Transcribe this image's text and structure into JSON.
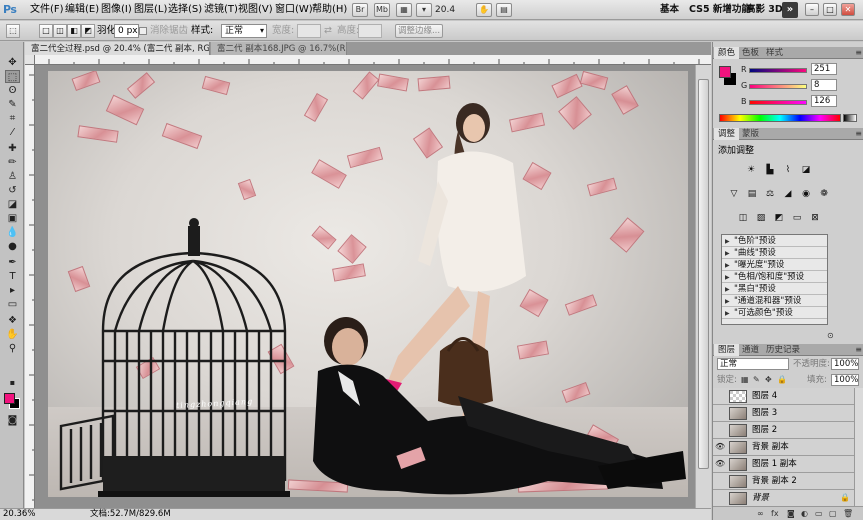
{
  "menubar": {
    "logo": "Ps",
    "items": [
      "文件(F)",
      "编辑(E)",
      "图像(I)",
      "图层(L)",
      "选择(S)",
      "滤镜(T)",
      "视图(V)",
      "窗口(W)",
      "帮助(H)"
    ],
    "zoom": "20.4",
    "workspaces": [
      "基本",
      "CS5 新增功能",
      "高影 3D"
    ],
    "more": "»"
  },
  "options": {
    "feather_label": "羽化:",
    "feather_value": "0 px",
    "antialias_label": "消除锯齿",
    "style_label": "样式:",
    "style_value": "正常",
    "width_label": "宽度:",
    "height_label": "高度:",
    "refine_label": "调整边缘..."
  },
  "tabs": [
    {
      "label": "富二代全过程.psd @ 20.4% (富二代 副本, RGB/8) *"
    },
    {
      "label": "富二代 副本168.JPG @ 16.7%(RGB/8)"
    }
  ],
  "canvas": {
    "watermark": "tingzhongqiang"
  },
  "status": {
    "zoom": "20.36%",
    "doc": "文档:52.7M/829.6M"
  },
  "color_panel": {
    "tabs": [
      "颜色",
      "色板",
      "样式"
    ],
    "r_label": "R",
    "r": "251",
    "g_label": "G",
    "g": "8",
    "b_label": "B",
    "b": "126",
    "fg": "#f2137e",
    "bg": "#000000"
  },
  "adjust_panel": {
    "tabs": [
      "调整",
      "蒙版"
    ],
    "title": "添加调整",
    "presets": [
      "\"色阶\"预设",
      "\"曲线\"预设",
      "\"曝光度\"预设",
      "\"色相/饱和度\"预设",
      "\"黑白\"预设",
      "\"通道混和器\"预设",
      "\"可选颜色\"预设"
    ]
  },
  "layers_panel": {
    "tabs": [
      "图层",
      "通道",
      "历史记录"
    ],
    "blend_mode": "正常",
    "opacity_label": "不透明度:",
    "opacity": "100%",
    "lock_label": "锁定:",
    "fill_label": "填充:",
    "fill": "100%",
    "layers": [
      {
        "name": "图层 4"
      },
      {
        "name": "图层 3"
      },
      {
        "name": "图层 2"
      },
      {
        "name": "背景 副本"
      },
      {
        "name": "图层 1 副本"
      },
      {
        "name": "背景 副本 2"
      },
      {
        "name": "背景"
      }
    ]
  }
}
